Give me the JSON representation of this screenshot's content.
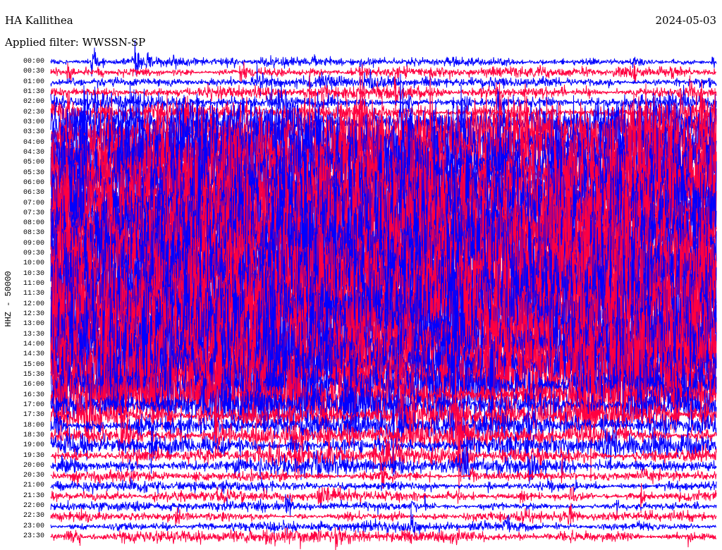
{
  "chart_data": {
    "type": "line",
    "title": "HA Kallithea",
    "subtitle": "Applied filter: WWSSN-SP",
    "date": "2024-05-03",
    "ylabel": "HHZ - 50000",
    "grid": false,
    "series_colors": [
      "#0000ff",
      "#ff0040"
    ],
    "background": "#ffffff",
    "rows": [
      {
        "label": "00:00",
        "relative_amplitude": 0.09
      },
      {
        "label": "00:30",
        "relative_amplitude": 0.1
      },
      {
        "label": "01:00",
        "relative_amplitude": 0.11
      },
      {
        "label": "01:30",
        "relative_amplitude": 0.12
      },
      {
        "label": "02:00",
        "relative_amplitude": 0.14
      },
      {
        "label": "02:30",
        "relative_amplitude": 0.17
      },
      {
        "label": "03:00",
        "relative_amplitude": 0.35
      },
      {
        "label": "03:30",
        "relative_amplitude": 0.55
      },
      {
        "label": "04:00",
        "relative_amplitude": 0.7
      },
      {
        "label": "04:30",
        "relative_amplitude": 0.8
      },
      {
        "label": "05:00",
        "relative_amplitude": 0.85
      },
      {
        "label": "05:30",
        "relative_amplitude": 0.9
      },
      {
        "label": "06:00",
        "relative_amplitude": 0.95
      },
      {
        "label": "06:30",
        "relative_amplitude": 1.0
      },
      {
        "label": "07:00",
        "relative_amplitude": 1.0
      },
      {
        "label": "07:30",
        "relative_amplitude": 1.0
      },
      {
        "label": "08:00",
        "relative_amplitude": 1.0
      },
      {
        "label": "08:30",
        "relative_amplitude": 1.0
      },
      {
        "label": "09:00",
        "relative_amplitude": 1.0
      },
      {
        "label": "09:30",
        "relative_amplitude": 1.0
      },
      {
        "label": "10:00",
        "relative_amplitude": 1.0
      },
      {
        "label": "10:30",
        "relative_amplitude": 1.0
      },
      {
        "label": "11:00",
        "relative_amplitude": 1.0
      },
      {
        "label": "11:30",
        "relative_amplitude": 1.0
      },
      {
        "label": "12:00",
        "relative_amplitude": 1.0
      },
      {
        "label": "12:30",
        "relative_amplitude": 1.0
      },
      {
        "label": "13:00",
        "relative_amplitude": 1.0
      },
      {
        "label": "13:30",
        "relative_amplitude": 0.95
      },
      {
        "label": "14:00",
        "relative_amplitude": 0.95
      },
      {
        "label": "14:30",
        "relative_amplitude": 0.9
      },
      {
        "label": "15:00",
        "relative_amplitude": 0.85
      },
      {
        "label": "15:30",
        "relative_amplitude": 0.75
      },
      {
        "label": "16:00",
        "relative_amplitude": 0.6
      },
      {
        "label": "16:30",
        "relative_amplitude": 0.45
      },
      {
        "label": "17:00",
        "relative_amplitude": 0.35
      },
      {
        "label": "17:30",
        "relative_amplitude": 0.28
      },
      {
        "label": "18:00",
        "relative_amplitude": 0.24
      },
      {
        "label": "18:30",
        "relative_amplitude": 0.22
      },
      {
        "label": "19:00",
        "relative_amplitude": 0.2
      },
      {
        "label": "19:30",
        "relative_amplitude": 0.18
      },
      {
        "label": "20:00",
        "relative_amplitude": 0.16
      },
      {
        "label": "20:30",
        "relative_amplitude": 0.11
      },
      {
        "label": "21:00",
        "relative_amplitude": 0.1
      },
      {
        "label": "21:30",
        "relative_amplitude": 0.1
      },
      {
        "label": "22:00",
        "relative_amplitude": 0.09
      },
      {
        "label": "22:30",
        "relative_amplitude": 0.09
      },
      {
        "label": "23:00",
        "relative_amplitude": 0.1
      },
      {
        "label": "23:30",
        "relative_amplitude": 0.12
      }
    ]
  }
}
